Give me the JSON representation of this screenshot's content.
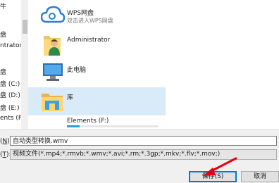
{
  "nav": {
    "items": [
      {
        "label": "牛"
      },
      {
        "label": "盘"
      },
      {
        "label": "ntrator"
      },
      {
        "label": "盘"
      },
      {
        "label": "盘 (C:)"
      },
      {
        "label": "盘 (D:)"
      },
      {
        "label": "盘 (E:)"
      },
      {
        "label": "ents (F:)"
      }
    ]
  },
  "files": {
    "wps": {
      "name": "WPS网盘",
      "subtitle": "双击进入WPS网盘"
    },
    "admin": {
      "name": "Administrator"
    },
    "pc": {
      "name": "此电脑"
    },
    "library": {
      "name": "库"
    },
    "elements": {
      "name": "Elements (F:)"
    }
  },
  "form": {
    "filename_label": "(N):",
    "filename_label_key": "N",
    "filename_value": "自动类型转换.wmv",
    "filetype_label": "(T):",
    "filetype_label_key": "T",
    "filetype_value": "视频文件(*.mp4;*.rmvb;*.wmv;*.avi;*.rm;*.3gp;*.mkv;*.flv;*.mov;)"
  },
  "buttons": {
    "save": "保存(S)",
    "cancel": "取消"
  },
  "colors": {
    "annotation_arrow": "#e60012",
    "selection": "#d9ebf9",
    "accent": "#0078d7"
  }
}
